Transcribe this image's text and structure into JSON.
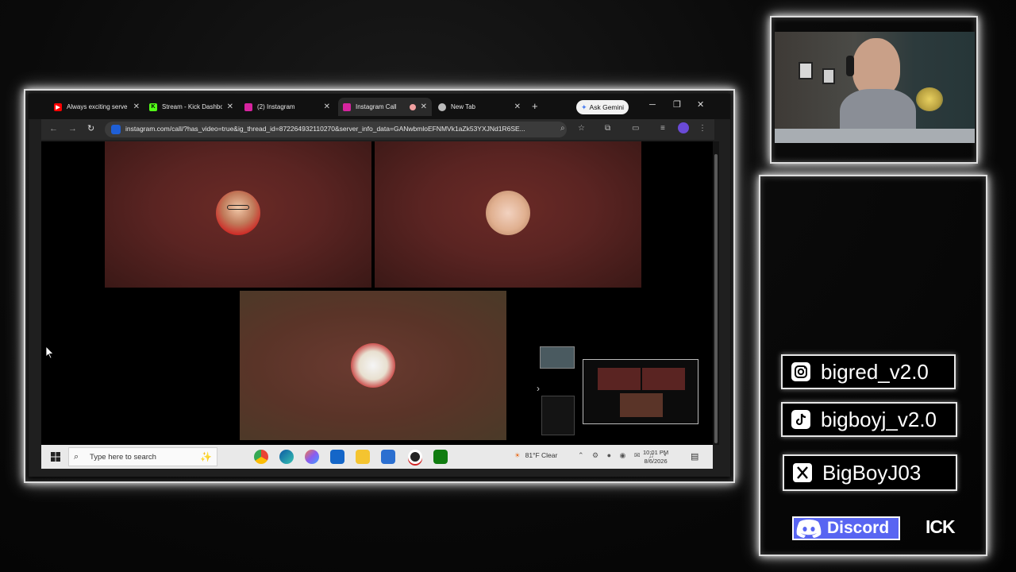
{
  "browser": {
    "tabs": [
      {
        "label": "Always exciting serve",
        "icon": "youtube-icon",
        "color": "#ff0000",
        "active": false
      },
      {
        "label": "Stream - Kick Dashbo",
        "icon": "kick-icon",
        "color": "#53fc18",
        "active": false
      },
      {
        "label": "(2) Instagram",
        "icon": "instagram-icon",
        "color": "#d6249f",
        "active": false
      },
      {
        "label": "Instagram Call",
        "icon": "instagram-icon",
        "color": "#d6249f",
        "active": true
      },
      {
        "label": "New Tab",
        "icon": "chrome-icon",
        "color": "#bbbbbb",
        "active": false
      }
    ],
    "new_tab": "+",
    "gemini_label": "Ask Gemini",
    "url": "instagram.com/call/?has_video=true&ig_thread_id=872264932110270&server_info_data=GANwbmloEFNMVk1aZk53YXJNd1R6SE..."
  },
  "taskbar": {
    "search_placeholder": "Type here to search",
    "weather": "81°F  Clear",
    "time": "10:01 PM",
    "date": "8/6/2026"
  },
  "socials": {
    "instagram": "bigred_v2.0",
    "tiktok": "bigboyj_v2.0",
    "x": "BigBoyJ03",
    "discord": "Discord",
    "kick": "ICK"
  },
  "colors": {
    "tile_red": "#5a2422",
    "discord": "#5865f2",
    "neon": "#dcdcdc"
  }
}
